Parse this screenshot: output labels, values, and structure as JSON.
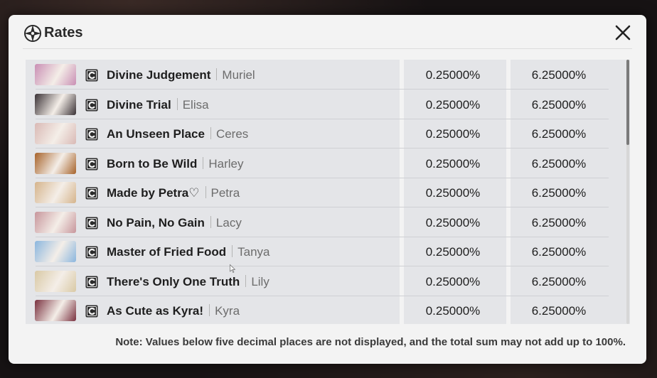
{
  "dialog": {
    "title": "Rates",
    "title_icon": "compass-star-icon",
    "close_icon": "close-icon"
  },
  "colors": {
    "dialog_bg": "#f3f3f3",
    "table_bg": "#e4e5e8",
    "text": "#1e1e1e",
    "muted_text": "#6c6c6c"
  },
  "rows": [
    {
      "item": "Divine Judgement",
      "character": "Muriel",
      "rate": "0.25000%",
      "cumulative": "6.25000%",
      "thumb_color": "#c98fb4",
      "tag_icon": "c-badge-icon"
    },
    {
      "item": "Divine Trial",
      "character": "Elisa",
      "rate": "0.25000%",
      "cumulative": "6.25000%",
      "thumb_color": "#3a3236",
      "tag_icon": "c-badge-icon"
    },
    {
      "item": "An Unseen Place",
      "character": "Ceres",
      "rate": "0.25000%",
      "cumulative": "6.25000%",
      "thumb_color": "#d9b9b5",
      "tag_icon": "c-badge-icon"
    },
    {
      "item": "Born to Be Wild",
      "character": "Harley",
      "rate": "0.25000%",
      "cumulative": "6.25000%",
      "thumb_color": "#a7632b",
      "tag_icon": "c-badge-icon"
    },
    {
      "item": "Made by Petra♡",
      "character": "Petra",
      "rate": "0.25000%",
      "cumulative": "6.25000%",
      "thumb_color": "#d5b48c",
      "tag_icon": "c-badge-icon"
    },
    {
      "item": "No Pain, No Gain",
      "character": "Lacy",
      "rate": "0.25000%",
      "cumulative": "6.25000%",
      "thumb_color": "#c7969c",
      "tag_icon": "c-badge-icon"
    },
    {
      "item": "Master of Fried Food",
      "character": "Tanya",
      "rate": "0.25000%",
      "cumulative": "6.25000%",
      "thumb_color": "#8bb6de",
      "tag_icon": "c-badge-icon"
    },
    {
      "item": "There's Only One Truth",
      "character": "Lily",
      "rate": "0.25000%",
      "cumulative": "6.25000%",
      "thumb_color": "#d9c9a5",
      "tag_icon": "c-badge-icon"
    },
    {
      "item": "As Cute as Kyra!",
      "character": "Kyra",
      "rate": "0.25000%",
      "cumulative": "6.25000%",
      "thumb_color": "#7a3240",
      "tag_icon": "c-badge-icon"
    }
  ],
  "note": "Note: Values below five decimal places are not displayed, and the total sum may not add up to 100%."
}
